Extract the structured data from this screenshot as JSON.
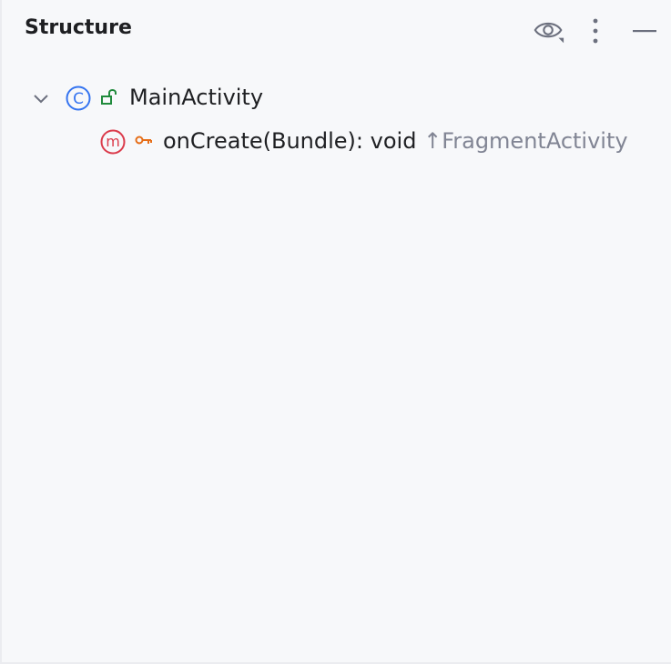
{
  "panel": {
    "title": "Structure",
    "actions": [
      {
        "name": "show-options",
        "icon": "eye-icon"
      },
      {
        "name": "more-options",
        "icon": "vertical-dots-icon"
      },
      {
        "name": "hide-panel",
        "icon": "minimize-icon"
      }
    ]
  },
  "tree": {
    "class_node": {
      "kind_badge": "C",
      "kind_icon": "class-icon",
      "visibility_icon": "public-lock-icon",
      "expanded": true,
      "label": "MainActivity"
    },
    "method_node": {
      "kind_badge": "m",
      "kind_icon": "method-icon",
      "visibility_icon": "protected-key-icon",
      "label": "onCreate(Bundle): void",
      "inherited_marker": "↑",
      "inherited_from": "FragmentActivity"
    }
  },
  "colors": {
    "panel_bg": "#f7f8fa",
    "class_badge": "#3574f0",
    "method_badge": "#db3b4b",
    "public_icon": "#208a3c",
    "protected_icon": "#e66d17",
    "muted_text": "#818594"
  }
}
